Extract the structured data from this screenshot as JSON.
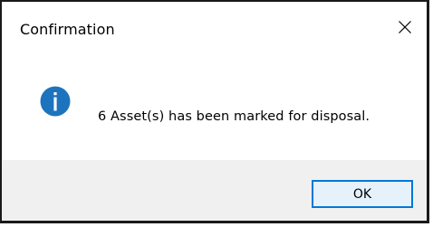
{
  "dialog": {
    "title": "Confirmation",
    "message": "6 Asset(s) has been marked for disposal.",
    "icon": "info-icon",
    "ok_label": "OK",
    "close_icon": "close-icon"
  },
  "colors": {
    "accent": "#0078d7",
    "icon_blue": "#1e73be",
    "footer_bg": "#f0f0f0",
    "button_bg": "#e5f1fb"
  }
}
